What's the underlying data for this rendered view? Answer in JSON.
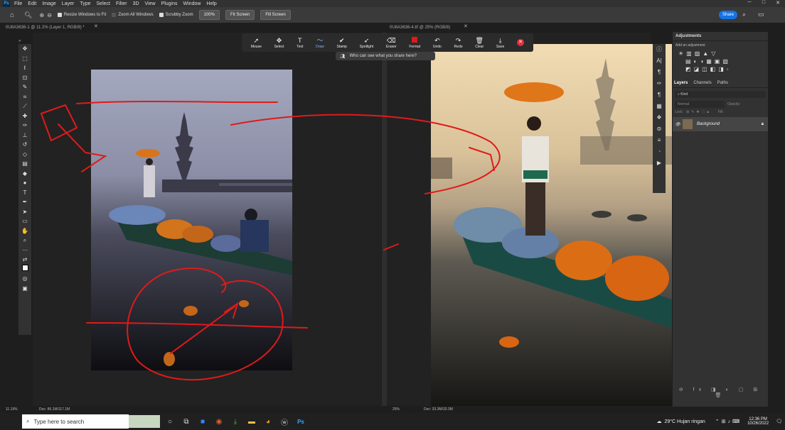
{
  "menubar": {
    "app_icon": "Ps",
    "items": [
      "File",
      "Edit",
      "Image",
      "Layer",
      "Type",
      "Select",
      "Filter",
      "3D",
      "View",
      "Plugins",
      "Window",
      "Help"
    ]
  },
  "options": {
    "resize_windows": "Resize Windows to Fit",
    "zoom_all": "Zoom All Windows",
    "scrubby": "Scrubby Zoom",
    "zoom_pct": "100%",
    "fit_screen": "Fit Screen",
    "fill_screen": "Fill Screen",
    "share": "Share"
  },
  "tabs": {
    "left": "0U8A3636-1 @ 11.2% (Layer 1, RGB/8) *",
    "right": "0U8A3636-4.tif @ 25% (RGB/8)"
  },
  "zoom_toolbar": {
    "buttons": [
      "Mouse",
      "Select",
      "Text",
      "Draw",
      "Stamp",
      "Spotlight",
      "Eraser",
      "Format",
      "Undo",
      "Redo",
      "Clear",
      "Save"
    ],
    "question": "Who can see what you share here?"
  },
  "panel": {
    "adjustments_title": "Adjustments",
    "add_adjustment": "Add an adjustment",
    "tabs": [
      "Layers",
      "Channels",
      "Paths"
    ],
    "kind": "Kind",
    "blend": "Normal",
    "opacity_label": "Opacity:",
    "lock_label": "Lock:",
    "fill_label": "Fill:",
    "layer_name": "Background"
  },
  "status": {
    "left_zoom": "11.19%",
    "left_doc": "Doc: 86.1M/117.1M",
    "right_zoom": "25%",
    "right_doc": "Doc: 33.3M/33.3M"
  },
  "taskbar": {
    "search_placeholder": "Type here to search",
    "weather": "29°C  Hujan ringan",
    "time": "12:36 PM",
    "date": "10/26/2022"
  }
}
